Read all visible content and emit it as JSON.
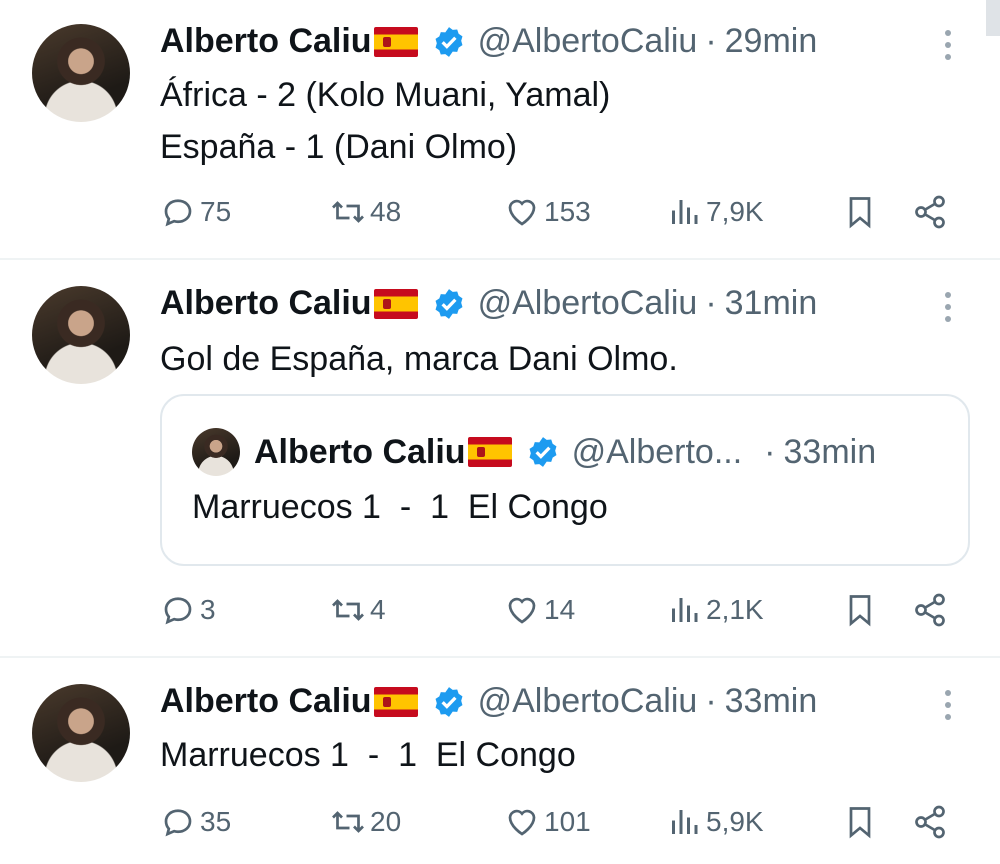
{
  "accent_color": "#1d9bf0",
  "tweets": [
    {
      "name": "Alberto Caliu",
      "handle": "@AlbertoCaliu",
      "separator": "·",
      "time": "29min",
      "lines": [
        "África - 2 (Kolo Muani, Yamal)",
        "España - 1 (Dani Olmo)"
      ],
      "replies": "75",
      "retweets": "48",
      "likes": "153",
      "views": "7,9K"
    },
    {
      "name": "Alberto Caliu",
      "handle": "@AlbertoCaliu",
      "separator": "·",
      "time": "31min",
      "lines": [
        "Gol de España, marca Dani Olmo."
      ],
      "quote": {
        "name": "Alberto Caliu",
        "handle": "@Alberto...",
        "separator": "·",
        "time": "33min",
        "text": "Marruecos 1  -  1  El Congo"
      },
      "replies": "3",
      "retweets": "4",
      "likes": "14",
      "views": "2,1K"
    },
    {
      "name": "Alberto Caliu",
      "handle": "@AlbertoCaliu",
      "separator": "·",
      "time": "33min",
      "lines": [
        "Marruecos 1  -  1  El Congo"
      ],
      "replies": "35",
      "retweets": "20",
      "likes": "101",
      "views": "5,9K"
    }
  ],
  "icons": {
    "reply": "reply-icon",
    "retweet": "retweet-icon",
    "like": "heart-icon",
    "views": "views-icon",
    "bookmark": "bookmark-icon",
    "share": "share-icon",
    "verified": "verified-badge-icon",
    "flag": "spain-flag-icon",
    "more": "more-options-icon"
  }
}
